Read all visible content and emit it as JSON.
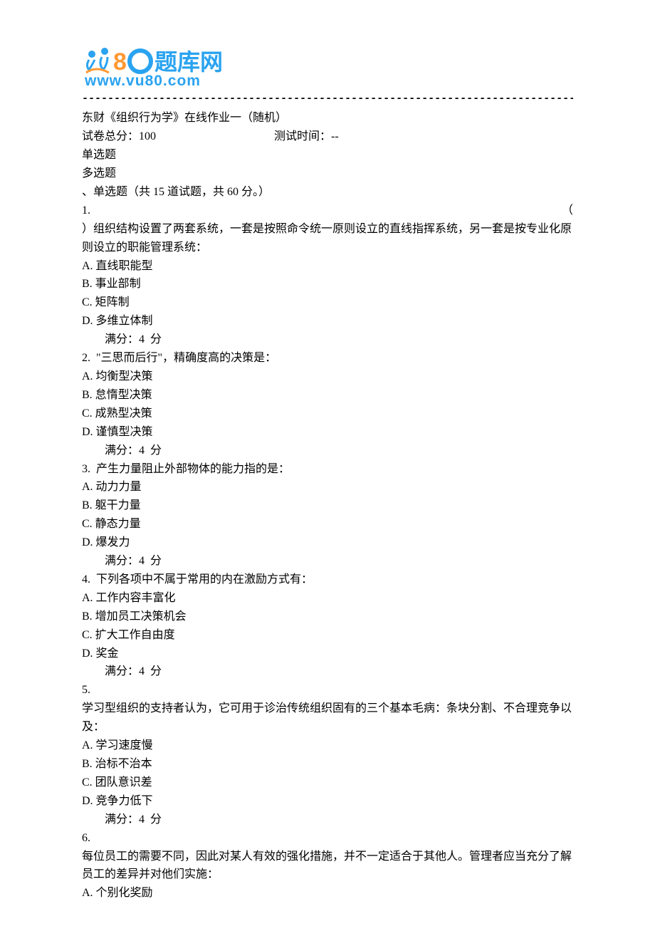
{
  "logo": {
    "top_text": "题库网",
    "url_text": "www.vu80.com"
  },
  "dashes": "------------------------------------------------------------------------------------------------------------------------",
  "header": {
    "title": "东财《组织行为学》在线作业一（随机）",
    "total_label": "试卷总分：",
    "total_value": "100",
    "time_label": "测试时间：",
    "time_value": "--",
    "nav_single": "单选题",
    "nav_multi": "多选题"
  },
  "section": {
    "title": "、单选题（共 15 道试题，共 60 分。）"
  },
  "score_text": "满分：4  分",
  "q1": {
    "num": "1.",
    "paren": "（",
    "stem": "）组织结构设置了两套系统，一套是按照命令统一原则设立的直线指挥系统，另一套是按专业化原则设立的职能管理系统：",
    "A": "A. 直线职能型",
    "B": "B. 事业部制",
    "C": "C. 矩阵制",
    "D": "D. 多维立体制"
  },
  "q2": {
    "stem": "2.  \"三思而后行\"，精确度高的决策是：",
    "A": "A. 均衡型决策",
    "B": "B. 怠惰型决策",
    "C": "C. 成熟型决策",
    "D": "D. 谨慎型决策"
  },
  "q3": {
    "stem": "3.  产生力量阻止外部物体的能力指的是：",
    "A": "A. 动力力量",
    "B": "B. 躯干力量",
    "C": "C. 静态力量",
    "D": "D. 爆发力"
  },
  "q4": {
    "stem": "4.  下列各项中不属于常用的内在激励方式有：",
    "A": "A. 工作内容丰富化",
    "B": "B. 增加员工决策机会",
    "C": "C. 扩大工作自由度",
    "D": "D. 奖金"
  },
  "q5": {
    "num": "5.",
    "stem": "学习型组织的支持者认为，它可用于诊治传统组织固有的三个基本毛病：条块分割、不合理竞争以及：",
    "A": "A. 学习速度慢",
    "B": "B. 治标不治本",
    "C": "C. 团队意识差",
    "D": "D. 竞争力低下"
  },
  "q6": {
    "num": "6.",
    "stem": "每位员工的需要不同，因此对某人有效的强化措施，并不一定适合于其他人。管理者应当充分了解员工的差异并对他们实施：",
    "A": "A. 个别化奖励"
  }
}
